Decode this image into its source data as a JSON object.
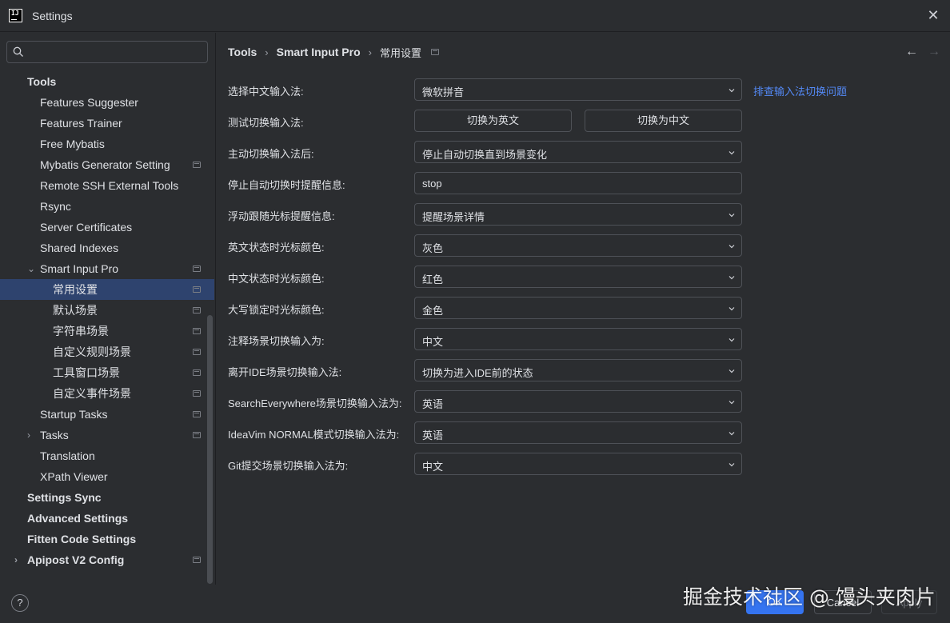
{
  "window": {
    "title": "Settings",
    "close": "✕"
  },
  "search": {
    "placeholder": "",
    "value": ""
  },
  "tree": [
    {
      "label": "Tools",
      "bold": true,
      "level": 0
    },
    {
      "label": "Features Suggester",
      "level": 1
    },
    {
      "label": "Features Trainer",
      "level": 1
    },
    {
      "label": "Free Mybatis",
      "level": 1
    },
    {
      "label": "Mybatis Generator Setting",
      "level": 1,
      "project": true
    },
    {
      "label": "Remote SSH External Tools",
      "level": 1
    },
    {
      "label": "Rsync",
      "level": 1
    },
    {
      "label": "Server Certificates",
      "level": 1
    },
    {
      "label": "Shared Indexes",
      "level": 1
    },
    {
      "label": "Smart Input Pro",
      "level": 1,
      "expanded": true,
      "project": true
    },
    {
      "label": "常用设置",
      "level": 2,
      "project": true,
      "selected": true
    },
    {
      "label": "默认场景",
      "level": 2,
      "project": true
    },
    {
      "label": "字符串场景",
      "level": 2,
      "project": true
    },
    {
      "label": "自定义规则场景",
      "level": 2,
      "project": true
    },
    {
      "label": "工具窗口场景",
      "level": 2,
      "project": true
    },
    {
      "label": "自定义事件场景",
      "level": 2,
      "project": true
    },
    {
      "label": "Startup Tasks",
      "level": 1,
      "project": true
    },
    {
      "label": "Tasks",
      "level": 1,
      "collapsed": true,
      "project": true
    },
    {
      "label": "Translation",
      "level": 1
    },
    {
      "label": "XPath Viewer",
      "level": 1
    },
    {
      "label": "Settings Sync",
      "bold": true,
      "level": 0
    },
    {
      "label": "Advanced Settings",
      "bold": true,
      "level": 0
    },
    {
      "label": "Fitten Code Settings",
      "bold": true,
      "level": 0
    },
    {
      "label": "Apipost V2 Config",
      "bold": true,
      "level": 0,
      "collapsed": true,
      "project": true
    }
  ],
  "breadcrumb": {
    "part1": "Tools",
    "part2": "Smart Input Pro",
    "part3": "常用设置",
    "sep": "›"
  },
  "nav": {
    "back": "←",
    "forward": "→"
  },
  "form": {
    "chinese_ime": {
      "label": "选择中文输入法:",
      "value": "微软拼音",
      "link": "排查输入法切换问题"
    },
    "test_switch": {
      "label": "测试切换输入法:",
      "btn_en": "切换为英文",
      "btn_zh": "切换为中文"
    },
    "after_manual": {
      "label": "主动切换输入法后:",
      "value": "停止自动切换直到场景变化"
    },
    "stop_tip": {
      "label": "停止自动切换时提醒信息:",
      "value": "stop"
    },
    "float_tip": {
      "label": "浮动跟随光标提醒信息:",
      "value": "提醒场景详情"
    },
    "en_cursor": {
      "label": "英文状态时光标颜色:",
      "value": "灰色"
    },
    "zh_cursor": {
      "label": "中文状态时光标颜色:",
      "value": "红色"
    },
    "caps_cursor": {
      "label": "大写锁定时光标颜色:",
      "value": "金色"
    },
    "comment_scene": {
      "label": "注释场景切换输入为:",
      "value": "中文"
    },
    "leave_ide": {
      "label": "离开IDE场景切换输入法:",
      "value": "切换为进入IDE前的状态"
    },
    "search_everywhere": {
      "label": "SearchEverywhere场景切换输入法为:",
      "value": "英语"
    },
    "ideavim": {
      "label": "IdeaVim NORMAL模式切换输入法为:",
      "value": "英语"
    },
    "git_commit": {
      "label": "Git提交场景切换输入法为:",
      "value": "中文"
    }
  },
  "footer": {
    "help": "?",
    "ok": "OK",
    "cancel": "Cancel",
    "apply": "Apply"
  },
  "watermark": "掘金技术社区 @ 馒头夹肉片",
  "colors": {
    "accent": "#3574f0",
    "selection": "#2e436e",
    "link": "#548af7",
    "background": "#2b2d30"
  }
}
